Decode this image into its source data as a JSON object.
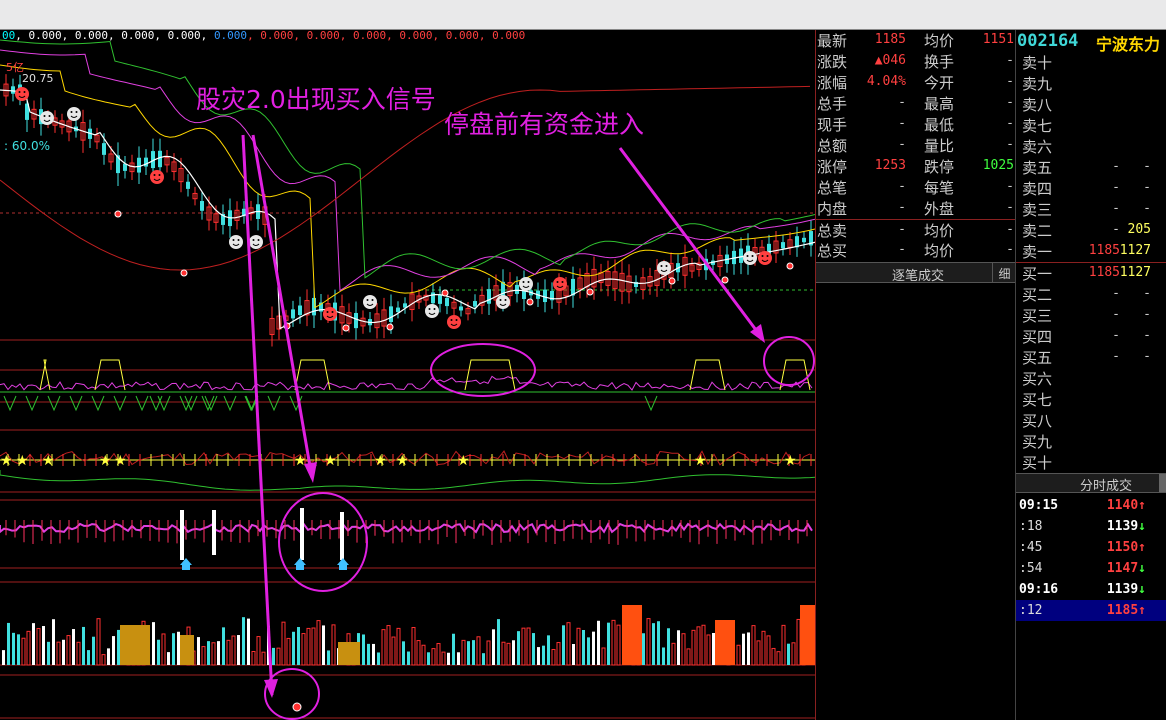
{
  "header": {
    "indicator_values": [
      {
        "text": "00",
        "color": "#00ffff"
      },
      {
        "text": ", 0.000, 0.000, 0.000, 0.000, ",
        "color": "#ffffff"
      },
      {
        "text": "0.000",
        "color": "#3399ff"
      },
      {
        "text": ", 0.000, 0.000, 0.000, 0.000, 0.000, 0.000",
        "color": "#ff4040"
      }
    ]
  },
  "main_chart": {
    "price_high_label": "20.75",
    "pct_label": ": 60.0%",
    "cap_label": "5亿",
    "annotations": {
      "buy_signal": "股灾2.0出现买入信号",
      "fund_inflow": "停盘前有资金进入"
    },
    "colors": {
      "annotation": "#e020e0",
      "up": "#ff3030",
      "down": "#40e0e0"
    }
  },
  "quote": {
    "rows": [
      {
        "l1": "最新",
        "v1": "1185",
        "c1": "#ff4040",
        "l2": "均价",
        "v2": "1151",
        "c2": "#ff4040"
      },
      {
        "l1": "涨跌",
        "v1": "▲046",
        "c1": "#ff4040",
        "l2": "换手",
        "v2": "-",
        "c2": "#cccccc"
      },
      {
        "l1": "涨幅",
        "v1": "4.04%",
        "c1": "#ff4040",
        "l2": "今开",
        "v2": "-",
        "c2": "#cccccc"
      },
      {
        "l1": "总手",
        "v1": "-",
        "c1": "#cccccc",
        "l2": "最高",
        "v2": "-",
        "c2": "#cccccc"
      },
      {
        "l1": "现手",
        "v1": "-",
        "c1": "#cccccc",
        "l2": "最低",
        "v2": "-",
        "c2": "#cccccc"
      },
      {
        "l1": "总额",
        "v1": "-",
        "c1": "#cccccc",
        "l2": "量比",
        "v2": "-",
        "c2": "#cccccc"
      },
      {
        "l1": "涨停",
        "v1": "1253",
        "c1": "#ff4040",
        "l2": "跌停",
        "v2": "1025",
        "c2": "#40ff40"
      },
      {
        "l1": "总笔",
        "v1": "-",
        "c1": "#cccccc",
        "l2": "每笔",
        "v2": "-",
        "c2": "#cccccc"
      },
      {
        "l1": "内盘",
        "v1": "-",
        "c1": "#cccccc",
        "l2": "外盘",
        "v2": "-",
        "c2": "#cccccc"
      },
      {
        "l1": "总卖",
        "v1": "-",
        "c1": "#cccccc",
        "l2": "均价",
        "v2": "-",
        "c2": "#cccccc"
      },
      {
        "l1": "总买",
        "v1": "-",
        "c1": "#cccccc",
        "l2": "均价",
        "v2": "-",
        "c2": "#cccccc"
      }
    ],
    "tick_button": "逐笔成交",
    "tick_button_small": "细"
  },
  "book": {
    "code": "002164",
    "name": "宁波东力",
    "sells": [
      {
        "label": "卖十",
        "price": "",
        "vol": ""
      },
      {
        "label": "卖九",
        "price": "",
        "vol": ""
      },
      {
        "label": "卖八",
        "price": "",
        "vol": ""
      },
      {
        "label": "卖七",
        "price": "",
        "vol": ""
      },
      {
        "label": "卖六",
        "price": "",
        "vol": ""
      },
      {
        "label": "卖五",
        "price": "-",
        "vol": "-"
      },
      {
        "label": "卖四",
        "price": "-",
        "vol": "-"
      },
      {
        "label": "卖三",
        "price": "-",
        "vol": "-"
      },
      {
        "label": "卖二",
        "price": "-",
        "vol": "205"
      },
      {
        "label": "卖一",
        "price": "1185",
        "vol": "1127"
      }
    ],
    "buys": [
      {
        "label": "买一",
        "price": "1185",
        "vol": "1127"
      },
      {
        "label": "买二",
        "price": "-",
        "vol": "-"
      },
      {
        "label": "买三",
        "price": "-",
        "vol": "-"
      },
      {
        "label": "买四",
        "price": "-",
        "vol": "-"
      },
      {
        "label": "买五",
        "price": "-",
        "vol": "-"
      },
      {
        "label": "买六",
        "price": "",
        "vol": ""
      },
      {
        "label": "买七",
        "price": "",
        "vol": ""
      },
      {
        "label": "买八",
        "price": "",
        "vol": ""
      },
      {
        "label": "买九",
        "price": "",
        "vol": ""
      },
      {
        "label": "买十",
        "price": "",
        "vol": ""
      }
    ],
    "timesales_button": "分时成交",
    "timesales": [
      {
        "time": "09:15",
        "price": "1140",
        "dir": "↑",
        "color": "#ff4040",
        "bright": true
      },
      {
        "time": ":18",
        "price": "1139",
        "dir": "↓",
        "color": "#ffffff",
        "bright": false
      },
      {
        "time": ":45",
        "price": "1150",
        "dir": "↑",
        "color": "#ff4040",
        "bright": false
      },
      {
        "time": ":54",
        "price": "1147",
        "dir": "↓",
        "color": "#ff4040",
        "bright": false
      },
      {
        "time": "09:16",
        "price": "1139",
        "dir": "↓",
        "color": "#ffffff",
        "bright": true
      },
      {
        "time": ":12",
        "price": "1185",
        "dir": "↑",
        "color": "#ff4040",
        "bright": false
      }
    ]
  }
}
